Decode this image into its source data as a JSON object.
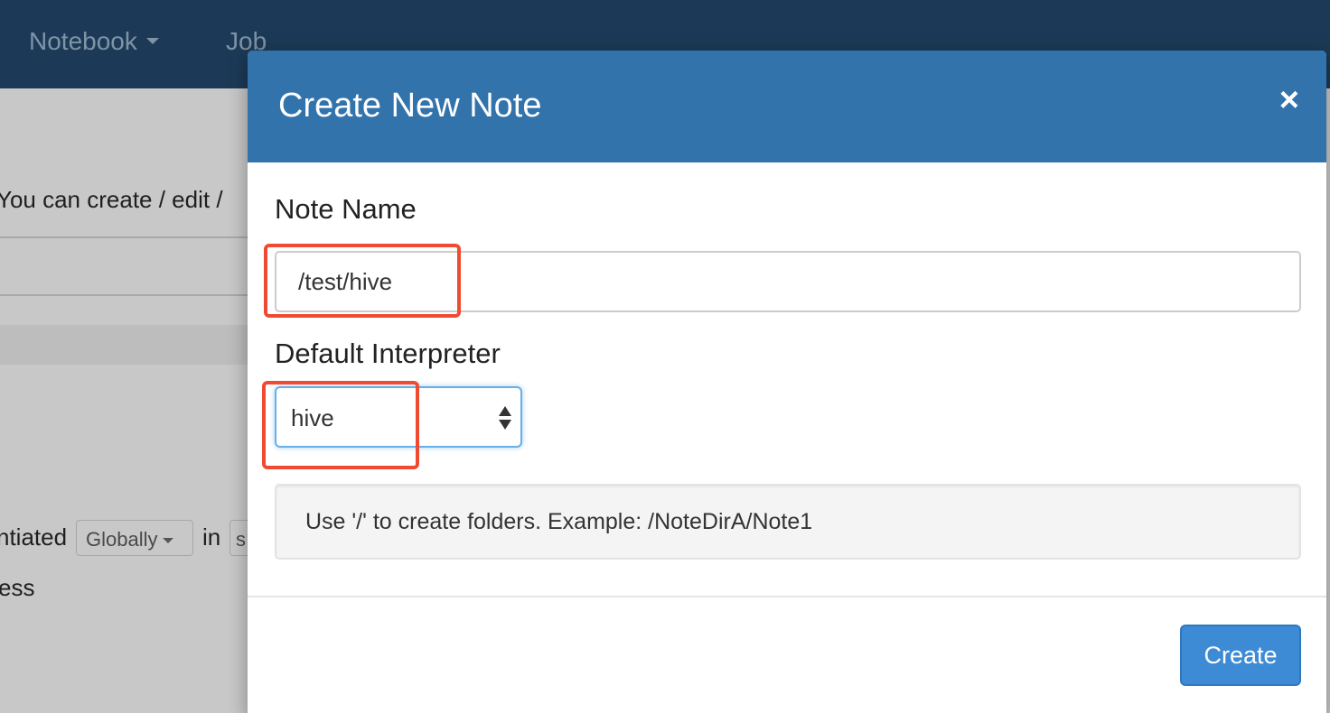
{
  "navbar": {
    "items": [
      {
        "label": "Notebook"
      },
      {
        "label": "Job"
      }
    ]
  },
  "background_page": {
    "intro_text": "You can create / edit /",
    "row_prefix": "ntiated",
    "scope_select": "Globally",
    "in_label": "in",
    "mode_box": "s",
    "trailing_text": "ess"
  },
  "modal": {
    "title": "Create New Note",
    "close_symbol": "×",
    "note_name_label": "Note Name",
    "note_name_value": "/test/hive",
    "interpreter_label": "Default Interpreter",
    "interpreter_value": "hive",
    "hint": "Use '/' to create folders. Example: /NoteDirA/Note1",
    "create_button": "Create"
  },
  "colors": {
    "navbar": "#1c3a57",
    "modal_header": "#3273ab",
    "primary_button": "#3d8bd4",
    "highlight": "#ef4b32"
  }
}
